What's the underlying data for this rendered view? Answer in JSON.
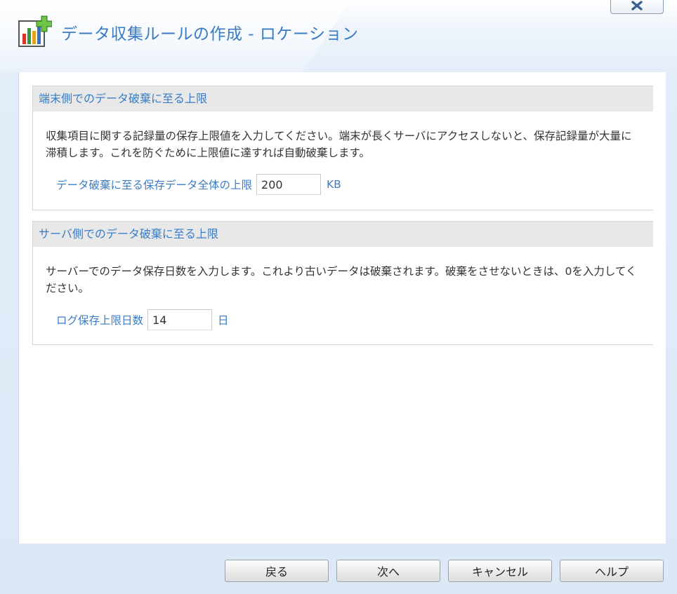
{
  "window": {
    "title": "データ収集ルールの作成 - ロケーション",
    "close_icon": "close-icon",
    "app_icon": "chart-add-icon"
  },
  "sections": [
    {
      "heading": "端末側でのデータ破棄に至る上限",
      "description": "収集項目に関する記録量の保存上限値を入力してください。端末が長くサーバにアクセスしないと、保存記録量が大量に滞積します。これを防ぐために上限値に達すれば自動破棄します。",
      "field_label": "データ破棄に至る保存データ全体の上限",
      "field_value": "200",
      "unit": "KB"
    },
    {
      "heading": "サーバ側でのデータ破棄に至る上限",
      "description": "サーバーでのデータ保存日数を入力します。これより古いデータは破棄されます。破棄をさせないときは、0を入力してください。",
      "field_label": "ログ保存上限日数",
      "field_value": "14",
      "unit": "日"
    }
  ],
  "footer": {
    "back_label": "戻る",
    "next_label": "次へ",
    "cancel_label": "キャンセル",
    "help_label": "ヘルプ"
  },
  "colors": {
    "accent": "#3a7cc4",
    "section_header_bg": "#e8e8e8"
  }
}
